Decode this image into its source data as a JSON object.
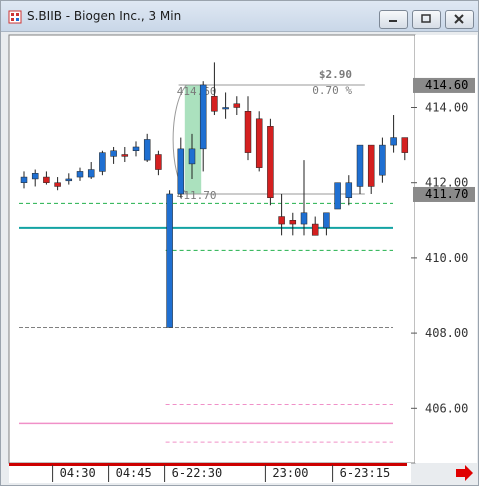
{
  "window": {
    "title": "S.BIIB - Biogen Inc., 3 Min",
    "icon": "chart-app-icon",
    "controls": [
      "minimize-icon",
      "maximize-icon",
      "close-icon"
    ]
  },
  "colors": {
    "up": "#1f6fd1",
    "down": "#d42020",
    "support_line": "#13a3a3",
    "green_dash": "#22b14c",
    "pink_line": "#f090c8",
    "gray_dash": "#808080",
    "measure_box": "#8fd7a8",
    "timeline_bar": "#cc0000",
    "nav_arrow": "#e00000"
  },
  "chart_data": {
    "type": "candlestick",
    "price_axis": {
      "ticks": [
        "414.00",
        "412.00",
        "410.00",
        "408.00",
        "406.00"
      ],
      "range": [
        405.0,
        415.6
      ]
    },
    "current_price_label": "414.60",
    "highlight_price_label": "411.70",
    "time_labels": [
      "04:30",
      "04:45",
      "6-22:30",
      "23:00",
      "6-23:15"
    ],
    "candles": [
      {
        "o": 412.0,
        "h": 412.3,
        "l": 411.85,
        "c": 412.15
      },
      {
        "o": 412.1,
        "h": 412.35,
        "l": 411.9,
        "c": 412.25
      },
      {
        "o": 412.15,
        "h": 412.3,
        "l": 411.95,
        "c": 412.0
      },
      {
        "o": 412.0,
        "h": 412.15,
        "l": 411.8,
        "c": 411.9
      },
      {
        "o": 412.05,
        "h": 412.25,
        "l": 411.95,
        "c": 412.1
      },
      {
        "o": 412.15,
        "h": 412.4,
        "l": 412.05,
        "c": 412.3
      },
      {
        "o": 412.15,
        "h": 412.55,
        "l": 412.1,
        "c": 412.35
      },
      {
        "o": 412.3,
        "h": 412.85,
        "l": 412.2,
        "c": 412.8
      },
      {
        "o": 412.7,
        "h": 412.95,
        "l": 412.5,
        "c": 412.85
      },
      {
        "o": 412.75,
        "h": 412.95,
        "l": 412.55,
        "c": 412.7
      },
      {
        "o": 412.85,
        "h": 413.1,
        "l": 412.7,
        "c": 412.95
      },
      {
        "o": 412.6,
        "h": 413.3,
        "l": 412.55,
        "c": 413.15
      },
      {
        "o": 412.75,
        "h": 412.85,
        "l": 412.2,
        "c": 412.35
      },
      {
        "o": 408.15,
        "h": 411.8,
        "l": 408.15,
        "c": 411.7
      },
      {
        "o": 411.7,
        "h": 413.2,
        "l": 411.6,
        "c": 412.9
      },
      {
        "o": 412.5,
        "h": 413.3,
        "l": 412.1,
        "c": 412.9
      },
      {
        "o": 412.9,
        "h": 414.7,
        "l": 412.3,
        "c": 414.6
      },
      {
        "o": 414.3,
        "h": 415.2,
        "l": 413.8,
        "c": 413.9
      },
      {
        "o": 414.0,
        "h": 414.4,
        "l": 413.7,
        "c": 414.0
      },
      {
        "o": 414.1,
        "h": 414.3,
        "l": 413.8,
        "c": 414.0
      },
      {
        "o": 413.9,
        "h": 414.3,
        "l": 412.6,
        "c": 412.8
      },
      {
        "o": 413.7,
        "h": 413.9,
        "l": 412.3,
        "c": 412.4
      },
      {
        "o": 413.5,
        "h": 413.7,
        "l": 411.4,
        "c": 411.6
      },
      {
        "o": 411.1,
        "h": 411.7,
        "l": 410.6,
        "c": 410.9
      },
      {
        "o": 411.0,
        "h": 411.2,
        "l": 410.6,
        "c": 410.9
      },
      {
        "o": 410.9,
        "h": 412.6,
        "l": 410.6,
        "c": 411.2
      },
      {
        "o": 410.9,
        "h": 411.1,
        "l": 410.6,
        "c": 410.6
      },
      {
        "o": 410.8,
        "h": 410.9,
        "l": 410.6,
        "c": 411.2
      },
      {
        "o": 411.3,
        "h": 412.0,
        "l": 411.3,
        "c": 412.0
      },
      {
        "o": 411.6,
        "h": 412.2,
        "l": 411.4,
        "c": 412.0
      },
      {
        "o": 411.9,
        "h": 413.0,
        "l": 411.7,
        "c": 413.0
      },
      {
        "o": 413.0,
        "h": 413.0,
        "l": 411.7,
        "c": 411.9
      },
      {
        "o": 412.2,
        "h": 413.2,
        "l": 412.0,
        "c": 413.0
      },
      {
        "o": 413.0,
        "h": 413.8,
        "l": 412.8,
        "c": 413.2
      },
      {
        "o": 413.2,
        "h": 413.2,
        "l": 412.6,
        "c": 412.8
      }
    ],
    "horizontal_lines": [
      {
        "kind": "green-dash",
        "price": 411.45,
        "from_index": 0
      },
      {
        "kind": "support",
        "price": 410.8,
        "from_index": 0
      },
      {
        "kind": "green-dash",
        "price": 410.2,
        "from_index": 13
      },
      {
        "kind": "gray-dash",
        "price": 408.15,
        "from_index": 0
      },
      {
        "kind": "pink-dash",
        "price": 406.1,
        "from_index": 13
      },
      {
        "kind": "pink-solid",
        "price": 405.6,
        "from_index": 0
      },
      {
        "kind": "pink-dash",
        "price": 405.1,
        "from_index": 13
      }
    ],
    "measurement": {
      "high": 414.6,
      "low": 411.7,
      "high_label": "414.60",
      "low_label": "411.70",
      "change_label": "$2.90",
      "percent_label": "0.70 %",
      "from_index": 13,
      "to_index": 29
    },
    "labeled_time_indices": [
      3,
      8,
      13,
      22,
      28
    ]
  }
}
